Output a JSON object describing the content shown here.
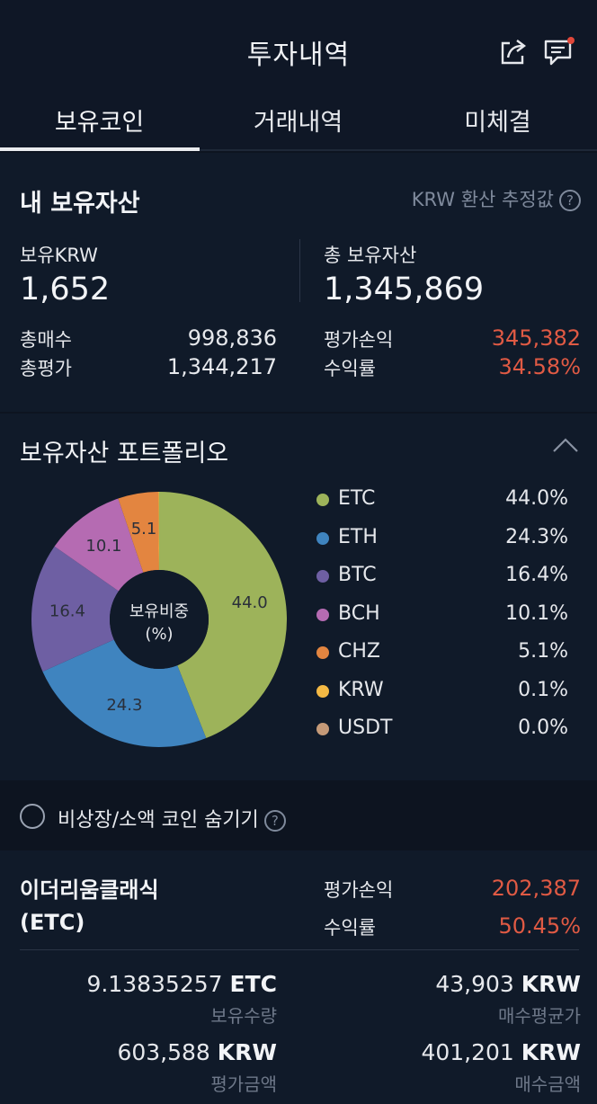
{
  "header": {
    "title": "투자내역"
  },
  "tabs": [
    "보유코인",
    "거래내역",
    "미체결"
  ],
  "summary": {
    "title": "내 보유자산",
    "note": "KRW 환산 추정값",
    "help": "?",
    "krw_label": "보유KRW",
    "krw_value": "1,652",
    "total_label": "총 보유자산",
    "total_value": "1,345,869",
    "buy_label": "총매수",
    "buy_value": "998,836",
    "eval_label": "총평가",
    "eval_value": "1,344,217",
    "pl_label": "평가손익",
    "pl_value": "345,382",
    "rate_label": "수익률",
    "rate_value": "34.58%"
  },
  "portfolio": {
    "title": "보유자산 포트폴리오",
    "center_label_1": "보유비중",
    "center_label_2": "(%)",
    "legend": [
      {
        "name": "ETC",
        "pct": "44.0%"
      },
      {
        "name": "ETH",
        "pct": "24.3%"
      },
      {
        "name": "BTC",
        "pct": "16.4%"
      },
      {
        "name": "BCH",
        "pct": "10.1%"
      },
      {
        "name": "CHZ",
        "pct": "5.1%"
      },
      {
        "name": "KRW",
        "pct": "0.1%"
      },
      {
        "name": "USDT",
        "pct": "0.0%"
      }
    ],
    "colors": [
      "#9db35a",
      "#3f84bf",
      "#6e5fa3",
      "#b56bb2",
      "#e38540",
      "#f4b944",
      "#c59a78"
    ]
  },
  "chart_data": {
    "type": "pie",
    "categories": [
      "ETC",
      "ETH",
      "BTC",
      "BCH",
      "CHZ",
      "KRW",
      "USDT"
    ],
    "values": [
      44.0,
      24.3,
      16.4,
      10.1,
      5.1,
      0.1,
      0.0
    ],
    "slice_labels": [
      "44.0",
      "24.3",
      "16.4",
      "10.1",
      "5.1",
      "",
      ""
    ]
  },
  "filter": {
    "label": "비상장/소액 코인 숨기기",
    "help": "?"
  },
  "holding": {
    "name_line1": "이더리움클래식",
    "name_line2": "(ETC)",
    "pl_label": "평가손익",
    "pl_value": "202,387",
    "rate_label": "수익률",
    "rate_value": "50.45%",
    "qty_value": "9.13835257",
    "qty_unit": "ETC",
    "qty_label": "보유수량",
    "avg_value": "43,903",
    "avg_unit": "KRW",
    "avg_label": "매수평균가",
    "eval_value": "603,588",
    "eval_unit": "KRW",
    "eval_label": "평가금액",
    "buy_value": "401,201",
    "buy_unit": "KRW",
    "buy_label": "매수금액"
  }
}
